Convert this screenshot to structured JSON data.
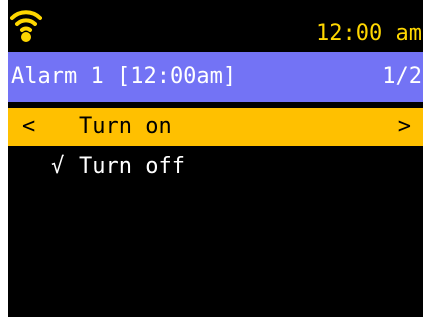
{
  "status_bar": {
    "wifi_icon": "wifi-icon",
    "time": "12:00 am"
  },
  "title_bar": {
    "title": "Alarm 1 [12:00am]",
    "page": "1/2"
  },
  "menu": {
    "items": [
      {
        "label": "Turn on",
        "selected": true,
        "left_glyph": "<",
        "right_glyph": ">"
      },
      {
        "label": "Turn off",
        "selected": false,
        "checked": true,
        "check_glyph": "√"
      }
    ]
  },
  "colors": {
    "background": "#000000",
    "accent_yellow": "#ffd700",
    "selection": "#ffc000",
    "title_bar": "#7373f5",
    "text": "#ffffff"
  }
}
